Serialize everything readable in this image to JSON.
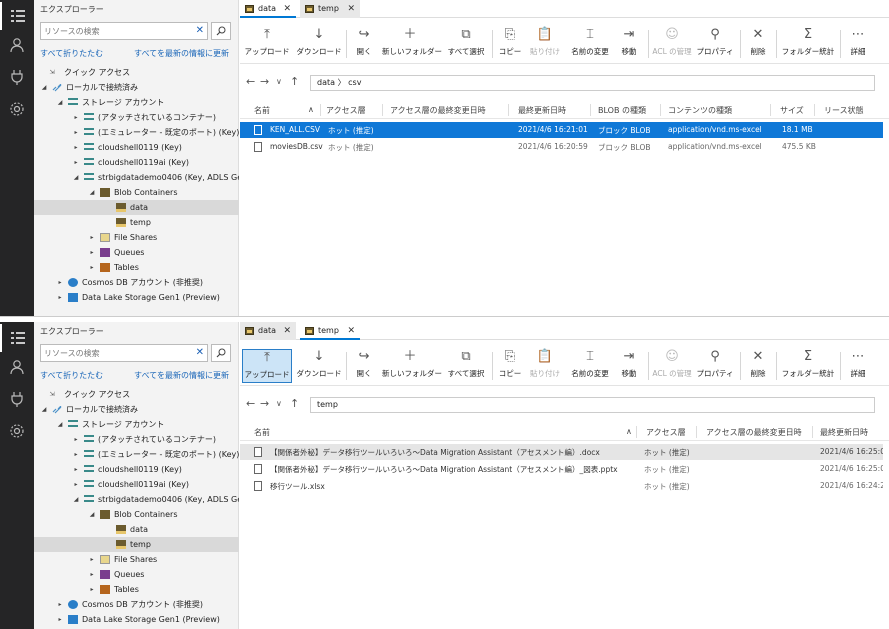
{
  "top": {
    "explorer": {
      "title": "エクスプローラー",
      "search_placeholder": "リソースの検索",
      "collapse_all": "すべて折りたたむ",
      "refresh_all": "すべてを最新の情報に更新",
      "tree": {
        "quick_access": "クイック アクセス",
        "local_attached": "ローカルで接続済み",
        "storage_accounts": "ストレージ アカウント",
        "attached_containers": "(アタッチされているコンテナー)",
        "emulator": "(エミュレーター - 既定のポート) (Key)",
        "cloudshell0119": "cloudshell0119 (Key)",
        "cloudshell0119ai": "cloudshell0119ai (Key)",
        "strbigdata": "strbigdatademo0406 (Key, ADLS Gen2)",
        "blob_containers": "Blob Containers",
        "data": "data",
        "temp": "temp",
        "file_shares": "File Shares",
        "queues": "Queues",
        "tables": "Tables",
        "cosmos": "Cosmos DB アカウント (非推奨)",
        "datalake": "Data Lake Storage Gen1 (Preview)"
      }
    },
    "tabs": [
      {
        "label": "data"
      },
      {
        "label": "temp"
      }
    ],
    "toolbar": {
      "upload": "アップロード",
      "download": "ダウンロード",
      "open": "開く",
      "new_folder": "新しいフォルダー",
      "select_all": "すべて選択",
      "copy": "コピー",
      "paste": "貼り付け",
      "rename": "名前の変更",
      "move": "移動",
      "acl": "ACL の管理",
      "properties": "プロパティ",
      "delete": "削除",
      "folder_stats": "フォルダー統計",
      "more": "詳細"
    },
    "path": {
      "segment1": "data",
      "segment2": "csv"
    },
    "columns": {
      "name": "名前",
      "access_tier": "アクセス層",
      "tier_modified": "アクセス層の最終変更日時",
      "last_modified": "最終更新日時",
      "blob_type": "BLOB の種類",
      "content_type": "コンテンツの種類",
      "size": "サイズ",
      "lease": "リース状態"
    },
    "rows": [
      {
        "name": "KEN_ALL.CSV",
        "tier": "ホット (推定)",
        "modified": "2021/4/6 16:21:01",
        "blob_type": "ブロック BLOB",
        "content_type": "application/vnd.ms-excel",
        "size": "18.1 MB"
      },
      {
        "name": "moviesDB.csv",
        "tier": "ホット (推定)",
        "modified": "2021/4/6 16:20:59",
        "blob_type": "ブロック BLOB",
        "content_type": "application/vnd.ms-excel",
        "size": "475.5 KB"
      }
    ]
  },
  "bottom": {
    "explorer": {
      "title": "エクスプローラー",
      "search_placeholder": "リソースの検索",
      "collapse_all": "すべて折りたたむ",
      "refresh_all": "すべてを最新の情報に更新",
      "tree": {
        "quick_access": "クイック アクセス",
        "local_attached": "ローカルで接続済み",
        "storage_accounts": "ストレージ アカウント",
        "attached_containers": "(アタッチされているコンテナー)",
        "emulator": "(エミュレーター - 既定のポート) (Key)",
        "cloudshell0119": "cloudshell0119 (Key)",
        "cloudshell0119ai": "cloudshell0119ai (Key)",
        "strbigdata": "strbigdatademo0406 (Key, ADLS Gen2)",
        "blob_containers": "Blob Containers",
        "data": "data",
        "temp": "temp",
        "file_shares": "File Shares",
        "queues": "Queues",
        "tables": "Tables",
        "cosmos": "Cosmos DB アカウント (非推奨)",
        "datalake": "Data Lake Storage Gen1 (Preview)"
      }
    },
    "tabs": [
      {
        "label": "data"
      },
      {
        "label": "temp"
      }
    ],
    "toolbar": {
      "upload": "アップロード",
      "download": "ダウンロード",
      "open": "開く",
      "new_folder": "新しいフォルダー",
      "select_all": "すべて選択",
      "copy": "コピー",
      "paste": "貼り付け",
      "rename": "名前の変更",
      "move": "移動",
      "acl": "ACL の管理",
      "properties": "プロパティ",
      "delete": "削除",
      "folder_stats": "フォルダー統計",
      "more": "詳細"
    },
    "path": {
      "segment1": "temp"
    },
    "columns": {
      "name": "名前",
      "access_tier": "アクセス層",
      "tier_modified": "アクセス層の最終変更日時",
      "last_modified": "最終更新日時"
    },
    "rows": [
      {
        "name": "【関係者外秘】データ移行ツールいろいろ～Data Migration Assistant（アセスメント編）.docx",
        "tier": "ホット (推定)",
        "modified": "2021/4/6 16:25:0"
      },
      {
        "name": "【関係者外秘】データ移行ツールいろいろ～Data Migration Assistant（アセスメント編）_図表.pptx",
        "tier": "ホット (推定)",
        "modified": "2021/4/6 16:25:0"
      },
      {
        "name": "移行ツール.xlsx",
        "tier": "ホット (推定)",
        "modified": "2021/4/6 16:24:2"
      }
    ]
  }
}
